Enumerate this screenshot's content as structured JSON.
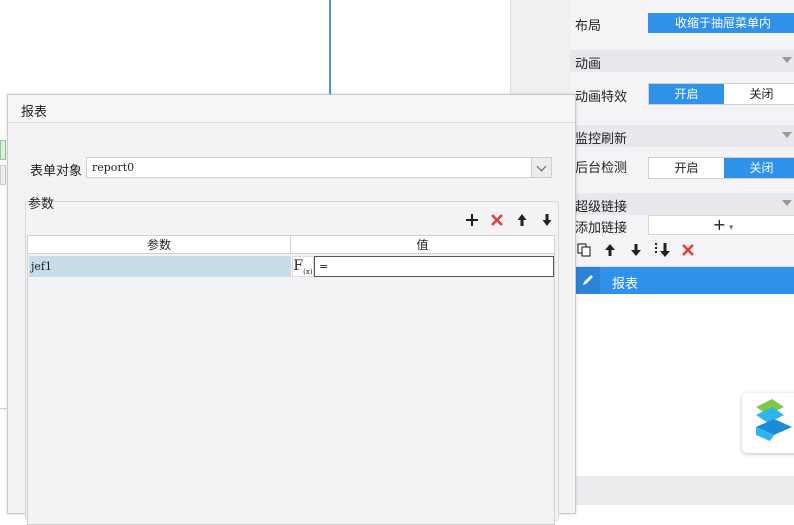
{
  "colors": {
    "accent": "#2f91ea",
    "delete_red": "#e03a3a",
    "selected_row": "#c9dcea"
  },
  "dialog": {
    "title": "报表",
    "form_label": "表单对象",
    "form_value": "report0",
    "param_section": "参数",
    "toolbar_icons": [
      "plus-icon",
      "delete-icon",
      "arrow-up-icon",
      "arrow-down-icon"
    ],
    "table": {
      "headers": [
        "参数",
        "值"
      ],
      "rows": [
        {
          "param": "jef1",
          "fx_label": "F",
          "value": "="
        }
      ]
    }
  },
  "props": {
    "layout_label": "布局",
    "layout_value": "收缩于抽屉菜单内",
    "animation_section": "动画",
    "animation_effect_label": "动画特效",
    "animation_on": "开启",
    "animation_off": "关闭",
    "animation_selected": "开启",
    "monitor_section": "监控刷新",
    "bg_check_label": "后台检测",
    "bg_on": "开启",
    "bg_off": "关闭",
    "bg_selected": "关闭",
    "hyperlink_section": "超级链接",
    "add_link_label": "添加链接",
    "add_link_button": "+",
    "link_items": [
      "报表"
    ]
  }
}
